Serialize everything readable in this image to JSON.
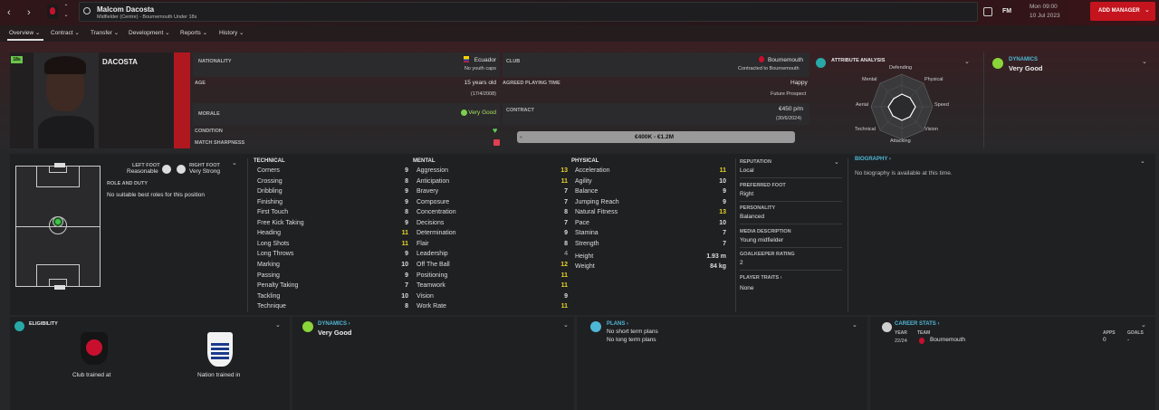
{
  "topbar": {
    "player_name": "Malcom Dacosta",
    "player_sub": "Midfielder (Centre) - Bournemouth Under 18s",
    "fm": "FM",
    "date_day": "Mon 09:00",
    "date": "10 Jul 2023",
    "add_manager": "ADD MANAGER"
  },
  "nav": [
    "Overview",
    "Contract",
    "Transfer",
    "Development",
    "Reports",
    "History"
  ],
  "profile": {
    "badge": "18s",
    "surname": "DACOSTA"
  },
  "info": {
    "nationality_label": "NATIONALITY",
    "nationality": "Ecuador",
    "youth_caps": "No youth caps",
    "age_label": "AGE",
    "age": "15 years old",
    "dob": "(17/4/2008)",
    "morale_label": "MORALE",
    "morale": "Very Good",
    "condition_label": "CONDITION",
    "sharpness_label": "MATCH SHARPNESS"
  },
  "club": {
    "club_label": "CLUB",
    "club": "Bournemouth",
    "contracted": "Contracted to Bournemouth",
    "apt_label": "AGREED PLAYING TIME",
    "apt": "Happy",
    "apt_sub": "Future Prospect",
    "contract_label": "CONTRACT",
    "wage": "€450 p/m",
    "expires": "(30/6/2024)",
    "value": "€400K - €1.2M"
  },
  "attr_analysis": {
    "title": "ATTRIBUTE ANALYSIS",
    "labels": [
      "Defending",
      "Physical",
      "Speed",
      "Vision",
      "Attacking",
      "Technical",
      "Aerial",
      "Mental"
    ]
  },
  "dynamics_top": {
    "title": "DYNAMICS",
    "value": "Very Good"
  },
  "pitch": {
    "left_foot_label": "LEFT FOOT",
    "left_foot": "Reasonable",
    "right_foot_label": "RIGHT FOOT",
    "right_foot": "Very Strong",
    "role_title": "ROLE AND DUTY",
    "role_text": "No suitable best roles for this position"
  },
  "technical": {
    "title": "TECHNICAL",
    "rows": [
      [
        "Corners",
        "9"
      ],
      [
        "Crossing",
        "8"
      ],
      [
        "Dribbling",
        "9"
      ],
      [
        "Finishing",
        "9"
      ],
      [
        "First Touch",
        "8"
      ],
      [
        "Free Kick Taking",
        "9"
      ],
      [
        "Heading",
        "11"
      ],
      [
        "Long Shots",
        "11"
      ],
      [
        "Long Throws",
        "9"
      ],
      [
        "Marking",
        "10"
      ],
      [
        "Passing",
        "9"
      ],
      [
        "Penalty Taking",
        "7"
      ],
      [
        "Tackling",
        "10"
      ],
      [
        "Technique",
        "8"
      ]
    ]
  },
  "mental": {
    "title": "MENTAL",
    "rows": [
      [
        "Aggression",
        "13"
      ],
      [
        "Anticipation",
        "11"
      ],
      [
        "Bravery",
        "7"
      ],
      [
        "Composure",
        "7"
      ],
      [
        "Concentration",
        "8"
      ],
      [
        "Decisions",
        "7"
      ],
      [
        "Determination",
        "9"
      ],
      [
        "Flair",
        "8"
      ],
      [
        "Leadership",
        "4"
      ],
      [
        "Off The Ball",
        "12"
      ],
      [
        "Positioning",
        "11"
      ],
      [
        "Teamwork",
        "11"
      ],
      [
        "Vision",
        "9"
      ],
      [
        "Work Rate",
        "11"
      ]
    ]
  },
  "physical": {
    "title": "PHYSICAL",
    "rows": [
      [
        "Acceleration",
        "11"
      ],
      [
        "Agility",
        "10"
      ],
      [
        "Balance",
        "9"
      ],
      [
        "Jumping Reach",
        "9"
      ],
      [
        "Natural Fitness",
        "13"
      ],
      [
        "Pace",
        "10"
      ],
      [
        "Stamina",
        "7"
      ],
      [
        "Strength",
        "7"
      ]
    ],
    "height_label": "Height",
    "height": "1.93 m",
    "weight_label": "Weight",
    "weight": "84 kg"
  },
  "side": {
    "reputation_label": "REPUTATION",
    "reputation": "Local",
    "pref_foot_label": "PREFERRED FOOT",
    "pref_foot": "Right",
    "personality_label": "PERSONALITY",
    "personality": "Balanced",
    "media_label": "MEDIA DESCRIPTION",
    "media": "Young midfielder",
    "gk_label": "GOALKEEPER RATING",
    "gk": "2",
    "traits_label": "PLAYER TRAITS",
    "traits": "None"
  },
  "biography": {
    "title": "BIOGRAPHY",
    "text": "No biography is available at this time."
  },
  "eligibility": {
    "title": "ELIGIBILITY",
    "club_caption": "Club trained at",
    "nation_caption": "Nation trained in"
  },
  "dynamics_bottom": {
    "title": "DYNAMICS",
    "value": "Very Good"
  },
  "plans": {
    "title": "PLANS",
    "short": "No short term plans",
    "long": "No long term plans"
  },
  "career": {
    "title": "CAREER STATS",
    "year_h": "YEAR",
    "team_h": "TEAM",
    "apps_h": "APPS",
    "goals_h": "GOALS",
    "year": "22/24",
    "team": "Bournemouth",
    "apps": "0",
    "goals": "-"
  }
}
